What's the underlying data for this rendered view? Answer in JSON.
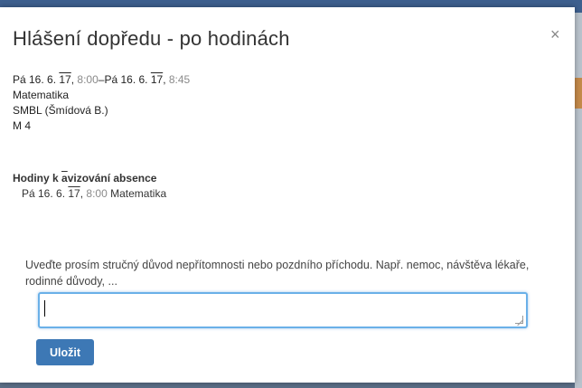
{
  "dialog": {
    "title": "Hlášení dopředu - po hodinách",
    "close_glyph": "×",
    "info": {
      "range_start_day": "Pá 16. 6. ",
      "range_start_year": "17",
      "range_start_comma": ",",
      "range_start_time": "8:00",
      "range_sep": "–Pá 16. 6. ",
      "range_end_year": "17",
      "range_end_comma": ",",
      "range_end_time": "8:45",
      "subject": "Matematika",
      "teacher": "SMBL (Šmídová B.)",
      "room": "M 4"
    },
    "hours_section": {
      "title_prefix": "Hodiny k ",
      "title_overlined": "a",
      "title_suffix": "vizování absence",
      "rows": [
        {
          "day": "Pá 16. 6. ",
          "year": "17",
          "comma": ",",
          "time": "8:00",
          "subject": "Matematika"
        }
      ]
    },
    "reason": {
      "label": "Uveďte prosím stručný důvod nepřítomnosti nebo pozdního příchodu. Např. nemoc, návštěva lékaře, rodinné důvody, ...",
      "value": ""
    },
    "save_label": "Uložit"
  },
  "colors": {
    "accent": "#3d78b5",
    "topbar": "#3d5f8e",
    "focus_border": "#6ab0e8"
  }
}
